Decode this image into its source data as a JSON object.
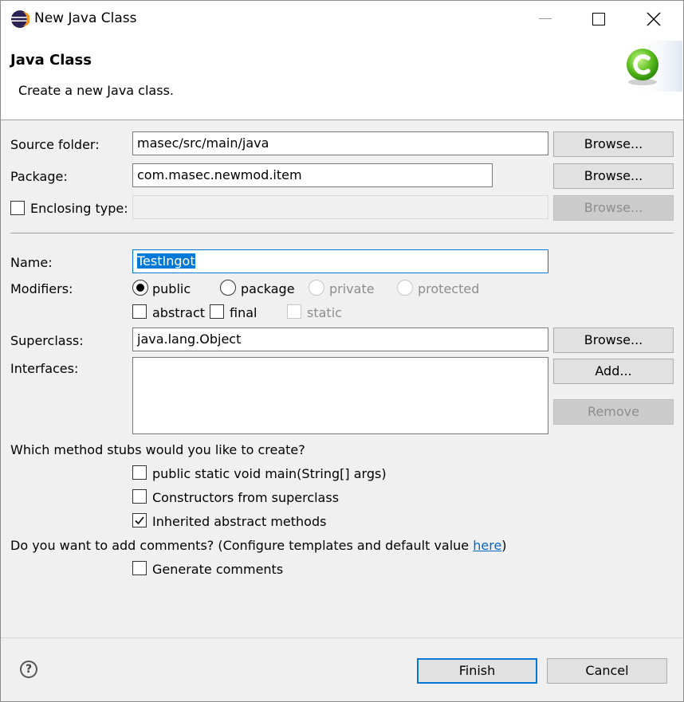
{
  "window": {
    "title": "New Java Class"
  },
  "banner": {
    "title": "Java Class",
    "description": "Create a new Java class."
  },
  "form": {
    "source_folder": {
      "label": "Source folder:",
      "value": "masec/src/main/java",
      "browse": "Browse..."
    },
    "package": {
      "label": "Package:",
      "value": "com.masec.newmod.item",
      "browse": "Browse..."
    },
    "enclosing_type": {
      "label": "Enclosing type:",
      "value": "",
      "checked": false,
      "browse": "Browse..."
    },
    "name": {
      "label": "Name:",
      "value": "TestIngot"
    },
    "modifiers": {
      "label": "Modifiers:",
      "public": "public",
      "package": "package",
      "private": "private",
      "protected": "protected",
      "abstract": "abstract",
      "final": "final",
      "static": "static",
      "selected": "public"
    },
    "superclass": {
      "label": "Superclass:",
      "value": "java.lang.Object",
      "browse": "Browse..."
    },
    "interfaces": {
      "label": "Interfaces:",
      "add": "Add...",
      "remove": "Remove",
      "items": []
    }
  },
  "stubs": {
    "question": "Which method stubs would you like to create?",
    "main": {
      "label": "public static void main(String[] args)",
      "checked": false
    },
    "constructors": {
      "label": "Constructors from superclass",
      "checked": false
    },
    "inherited": {
      "label": "Inherited abstract methods",
      "checked": true
    }
  },
  "comments": {
    "question_prefix": "Do you want to add comments? (Configure templates and default value ",
    "link": "here",
    "question_suffix": ")",
    "generate": {
      "label": "Generate comments",
      "checked": false
    }
  },
  "footer": {
    "help": "?",
    "finish": "Finish",
    "cancel": "Cancel"
  },
  "colors": {
    "accent": "#0078d7",
    "link": "#0066cc"
  }
}
